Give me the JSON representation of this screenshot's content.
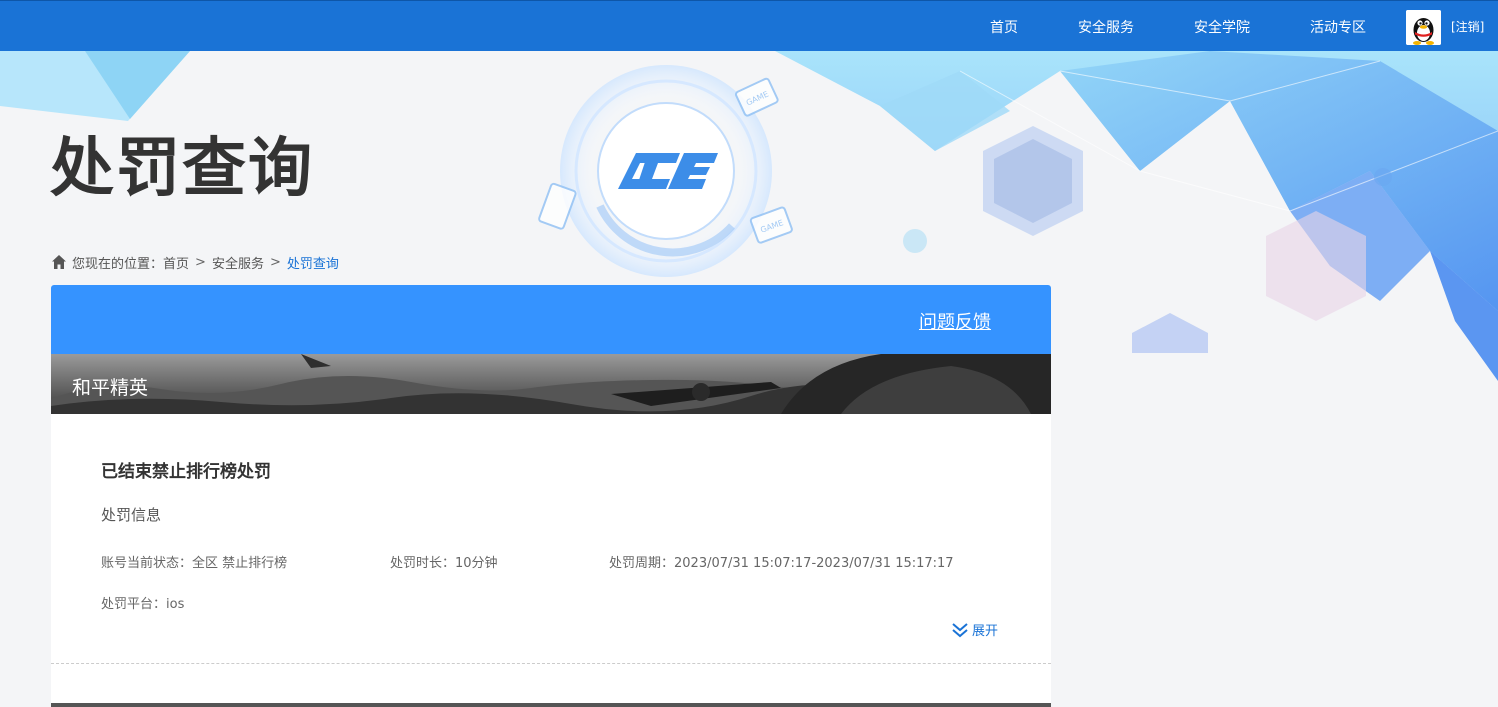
{
  "nav": {
    "home": "首页",
    "service": "安全服务",
    "academy": "安全学院",
    "activity": "活动专区",
    "logout": "[注销]"
  },
  "page": {
    "title": "处罚查询"
  },
  "breadcrumb": {
    "prefix": "您现在的位置：",
    "home": "首页",
    "sep1": ">",
    "service": "安全服务",
    "sep2": ">",
    "current": "处罚查询"
  },
  "panel": {
    "feedback": "问题反馈",
    "game": "和平精英"
  },
  "record": {
    "title": "已结束禁止排行榜处罚",
    "subtitle": "处罚信息",
    "status": "账号当前状态：全区 禁止排行榜",
    "duration": "处罚时长：10分钟",
    "period": "处罚周期：2023/07/31 15:07:17-2023/07/31 15:17:17",
    "platform": "处罚平台：ios",
    "expand": "展开"
  },
  "colors": {
    "nav_bg": "#1a73d6",
    "panel_head": "#3593ff",
    "accent": "#1a73d6"
  },
  "icons": {
    "home": "home-icon",
    "expand": "double-chevron-down-icon",
    "avatar": "qq-penguin-avatar",
    "logo": "ace-logo"
  }
}
